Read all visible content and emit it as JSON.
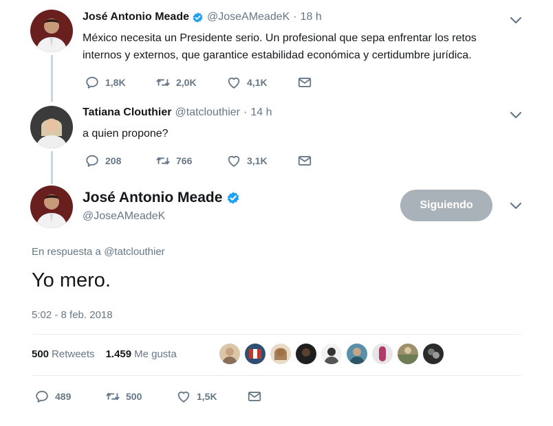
{
  "tweets": [
    {
      "name": "José Antonio Meade",
      "verified": true,
      "handle": "@JoseAMeadeK",
      "time": "18 h",
      "text_line1": "México necesita un Presidente serio. Un profesional que sepa enfrentar los retos",
      "text_line2": "internos y externos, que garantice estabilidad económica y certidumbre jurídica.",
      "replies": "1,8K",
      "retweets": "2,0K",
      "likes": "4,1K"
    },
    {
      "name": "Tatiana Clouthier",
      "verified": false,
      "handle": "@tatclouthier",
      "time": "14 h",
      "text": "a quien propone?",
      "replies": "208",
      "retweets": "766",
      "likes": "3,1K"
    }
  ],
  "main": {
    "name": "José Antonio Meade",
    "verified": true,
    "handle": "@JoseAMeadeK",
    "follow_label": "Siguiendo",
    "reply_prefix": "En respuesta a",
    "reply_mention": "@tatclouthier",
    "text": "Yo mero.",
    "timestamp": "5:02 - 8 feb. 2018",
    "retweets_count": "500",
    "retweets_label": "Retweets",
    "likes_count": "1.459",
    "likes_label": "Me gusta",
    "replies": "489",
    "retweets": "500",
    "likes": "1,5K"
  },
  "separator": "·",
  "colors": {
    "verified": "#1da1f2",
    "muted": "#657786",
    "follow_button": "#aab2b9"
  },
  "icons": [
    "reply-icon",
    "retweet-icon",
    "like-icon",
    "message-icon",
    "verified-icon",
    "chevron-down-icon"
  ]
}
